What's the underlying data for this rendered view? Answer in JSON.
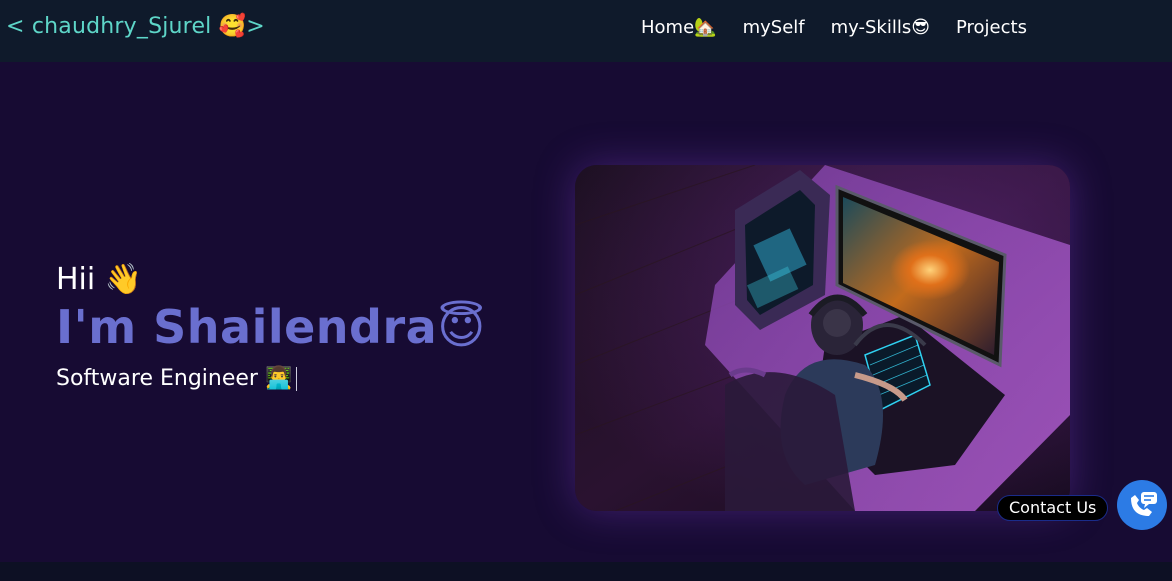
{
  "navbar": {
    "brand": "< chaudhry_Sjurel 🥰>",
    "links": [
      "Home🏡",
      "mySelf",
      "my-Skills😎",
      "Projects"
    ]
  },
  "hero": {
    "greeting": "Hii 👋",
    "name": "I'm Shailendra😇",
    "role": "Software Engineer 👨‍💻"
  },
  "contact": {
    "label": "Contact Us",
    "icon": "phone-chat-icon"
  },
  "colors": {
    "navbar_bg": "#0f1a2b",
    "hero_bg": "#170b33",
    "brand": "#5ed6c8",
    "name_accent": "#6a6fcf",
    "contact_button": "#2c7be5"
  }
}
